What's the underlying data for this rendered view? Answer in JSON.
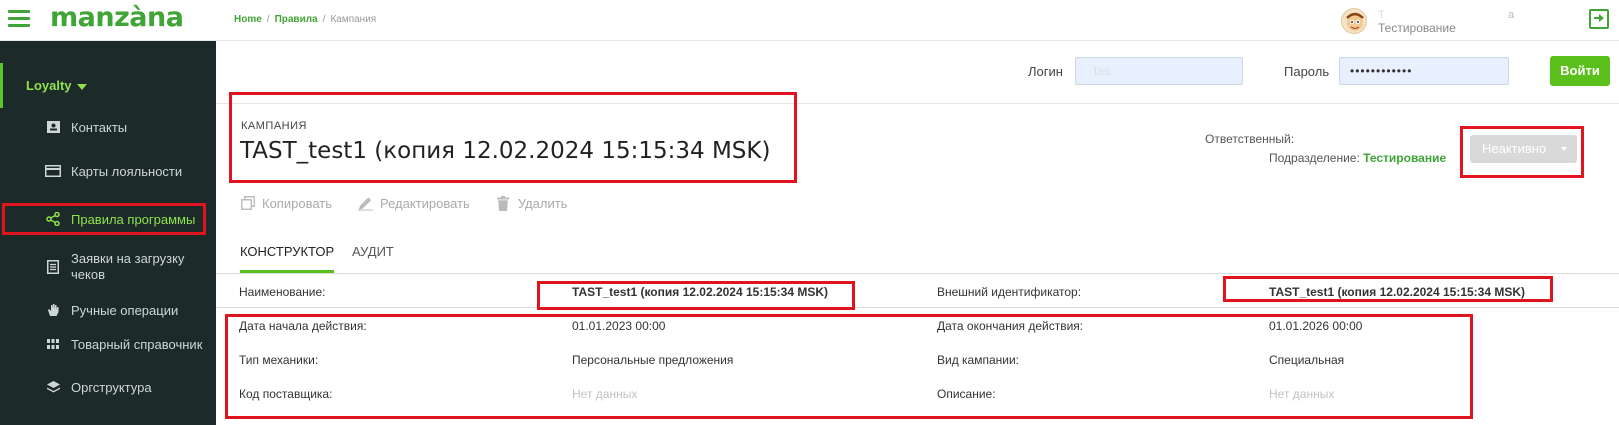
{
  "brand": {
    "logo": "manzàna"
  },
  "sidebar": {
    "section": "Loyalty",
    "items": [
      {
        "label": "Контакты",
        "icon": "contact-card-icon"
      },
      {
        "label": "Карты лояльности",
        "icon": "card-icon"
      },
      {
        "label": "Правила программы",
        "icon": "share-nodes-icon",
        "active": true
      },
      {
        "label": "Заявки на загрузку чеков",
        "icon": "receipt-list-icon"
      },
      {
        "label": "Ручные операции",
        "icon": "hand-icon"
      },
      {
        "label": "Товарный справочник",
        "icon": "grid-icon"
      },
      {
        "label": "Оргструктура",
        "icon": "layers-icon"
      }
    ]
  },
  "header": {
    "breadcrumb": [
      "Home",
      "Правила",
      "Кампания"
    ],
    "user_short": "Т",
    "user_tag": "а",
    "user_dept": "Тестирование"
  },
  "login": {
    "login_label": "Логин",
    "login_value": "tas",
    "password_label": "Пароль",
    "password_value": "••••••••••••",
    "submit_label": "Войти"
  },
  "campaign": {
    "section_label": "КАМПАНИЯ",
    "title": "TAST_test1 (копия 12.02.2024 15:15:34 MSK)",
    "responsible_label": "Ответственный:",
    "department_label": "Подразделение:",
    "department_value": "Тестирование",
    "status": "Неактивно"
  },
  "actions": {
    "copy": "Копировать",
    "edit": "Редактировать",
    "delete": "Удалить"
  },
  "tabs": {
    "constructor": "КОНСТРУКТОР",
    "audit": "АУДИТ"
  },
  "fields": {
    "name_label": "Наименование:",
    "name_value": "TAST_test1 (копия 12.02.2024 15:15:34 MSK)",
    "ext_id_label": "Внешний идентификатор:",
    "ext_id_value": "TAST_test1 (копия 12.02.2024 15:15:34 MSK)",
    "start_label": "Дата начала действия:",
    "start_value": "01.01.2023 00:00",
    "end_label": "Дата окончания действия:",
    "end_value": "01.01.2026 00:00",
    "mechanic_label": "Тип механики:",
    "mechanic_value": "Персональные предложения",
    "kind_label": "Вид кампании:",
    "kind_value": "Специальная",
    "supplier_label": "Код поставщика:",
    "supplier_value": "Нет данных",
    "description_label": "Описание:",
    "description_value": "Нет данных"
  },
  "colors": {
    "brand_green": "#3fa536",
    "button_green": "#5bc01c",
    "annotation_red": "#e0141e",
    "sidebar_bg": "#1c2a2a"
  }
}
